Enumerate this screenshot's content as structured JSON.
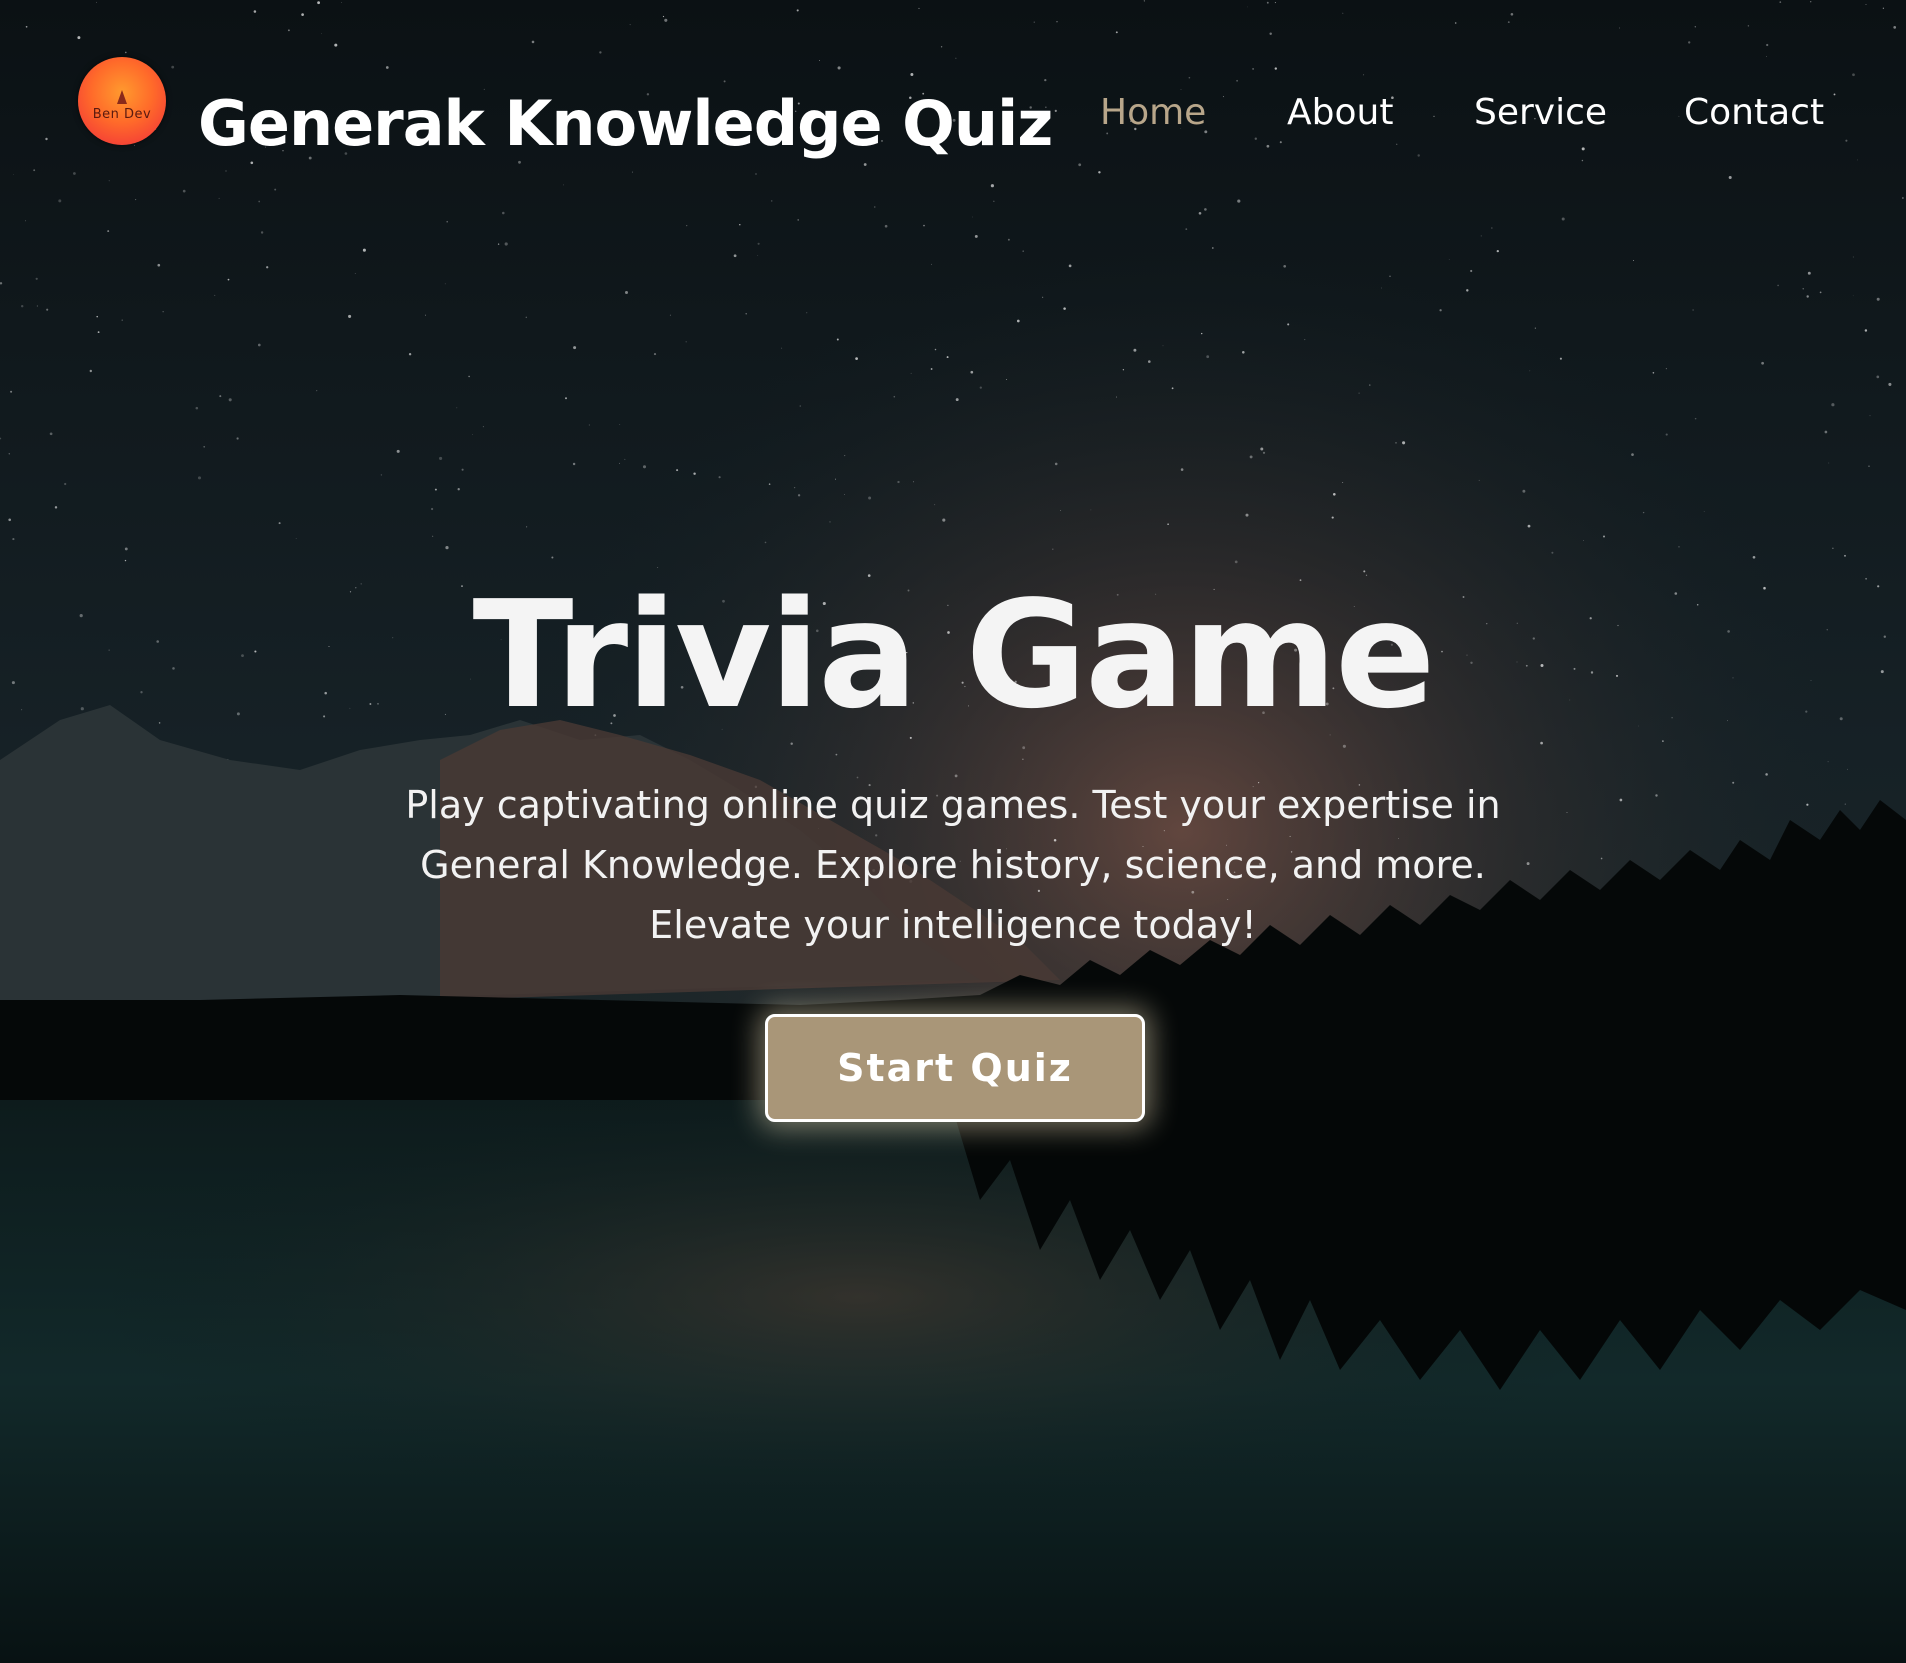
{
  "header": {
    "logo_text": "Ben Dev",
    "site_title": "Generak Knowledge Quiz"
  },
  "nav": {
    "items": [
      {
        "label": "Home",
        "active": true
      },
      {
        "label": "About",
        "active": false
      },
      {
        "label": "Service",
        "active": false
      },
      {
        "label": "Contact",
        "active": false
      }
    ]
  },
  "hero": {
    "title": "Trivia Game",
    "description_lines": [
      "Play captivating online quiz games. Test your expertise in",
      "General Knowledge. Explore history, science, and more.",
      "Elevate your intelligence today!"
    ],
    "button_label": "Start Quiz"
  },
  "colors": {
    "accent": "#a99678",
    "nav_active": "#b8a68a",
    "text": "#ffffff",
    "background": "#05090a"
  },
  "icons": {
    "logo": "ben-dev-logo-icon"
  }
}
